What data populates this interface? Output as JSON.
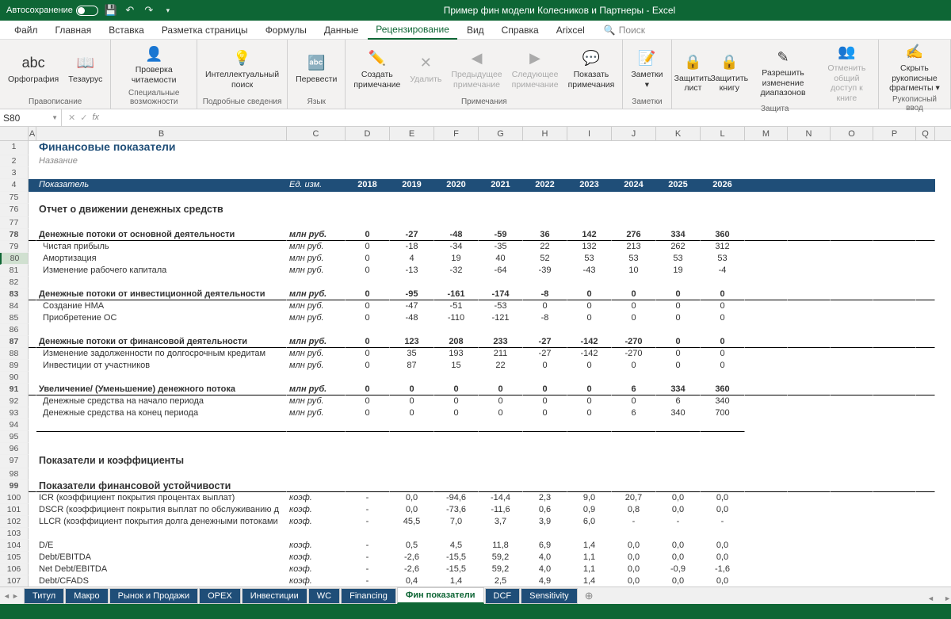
{
  "titlebar": {
    "autosave": "Автосохранение",
    "doc": "Пример фин модели Колесников и Партнеры - Excel"
  },
  "menu": [
    "Файл",
    "Главная",
    "Вставка",
    "Разметка страницы",
    "Формулы",
    "Данные",
    "Рецензирование",
    "Вид",
    "Справка",
    "Arixcel"
  ],
  "search": "Поиск",
  "ribbon": {
    "g1": {
      "label": "Правописание",
      "b": [
        {
          "t": "Орфография"
        },
        {
          "t": "Тезаурус"
        }
      ]
    },
    "g2": {
      "label": "Специальные возможности",
      "b": [
        {
          "t": "Проверка\nчитаемости"
        }
      ]
    },
    "g3": {
      "label": "Подробные сведения",
      "b": [
        {
          "t": "Интеллектуальный\nпоиск"
        }
      ]
    },
    "g4": {
      "label": "Язык",
      "b": [
        {
          "t": "Перевести"
        }
      ]
    },
    "g5": {
      "label": "Примечания",
      "b": [
        {
          "t": "Создать\nпримечание"
        },
        {
          "t": "Удалить",
          "d": true
        },
        {
          "t": "Предыдущее\nпримечание",
          "d": true
        },
        {
          "t": "Следующее\nпримечание",
          "d": true
        },
        {
          "t": "Показать\nпримечания"
        }
      ]
    },
    "g6": {
      "label": "Заметки",
      "b": [
        {
          "t": "Заметки\n▾"
        }
      ]
    },
    "g7": {
      "label": "Защита",
      "b": [
        {
          "t": "Защитить\nлист"
        },
        {
          "t": "Защитить\nкнигу"
        },
        {
          "t": "Разрешить изменение\nдиапазонов"
        },
        {
          "t": "Отменить общий\nдоступ к книге",
          "d": true
        }
      ]
    },
    "g8": {
      "label": "Рукописный ввод",
      "b": [
        {
          "t": "Скрыть рукописные\nфрагменты ▾"
        }
      ]
    }
  },
  "namebox": "S80",
  "cols": [
    "A",
    "B",
    "C",
    "D",
    "E",
    "F",
    "G",
    "H",
    "I",
    "J",
    "K",
    "L",
    "M",
    "N",
    "O",
    "P",
    "Q"
  ],
  "title": "Финансовые показатели",
  "subtitle": "Название",
  "hdr": {
    "label": "Показатель",
    "unit": "Ед. изм.",
    "years": [
      "2018",
      "2019",
      "2020",
      "2021",
      "2022",
      "2023",
      "2024",
      "2025",
      "2026"
    ]
  },
  "s1": "Отчет о движении денежных средств",
  "s2": "Показатели и коэффициенты",
  "s3": "Показатели финансовой устойчивости",
  "u_mln": "млн руб.",
  "u_k": "коэф.",
  "chart_data": {
    "type": "table",
    "rows": [
      {
        "r": 78,
        "b": 1,
        "name": "Денежные потоки от основной деятельности",
        "u": "млн руб.",
        "v": [
          "0",
          "-27",
          "-48",
          "-59",
          "36",
          "142",
          "276",
          "334",
          "360"
        ]
      },
      {
        "r": 79,
        "name": "Чистая прибыль",
        "u": "млн руб.",
        "v": [
          "0",
          "-18",
          "-34",
          "-35",
          "22",
          "132",
          "213",
          "262",
          "312"
        ]
      },
      {
        "r": 80,
        "name": "Амортизация",
        "u": "млн руб.",
        "v": [
          "0",
          "4",
          "19",
          "40",
          "52",
          "53",
          "53",
          "53",
          "53"
        ]
      },
      {
        "r": 81,
        "name": "Изменение рабочего капитала",
        "u": "млн руб.",
        "v": [
          "0",
          "-13",
          "-32",
          "-64",
          "-39",
          "-43",
          "10",
          "19",
          "-4"
        ]
      },
      {
        "r": 83,
        "b": 1,
        "name": "Денежные потоки от инвестиционной деятельности",
        "u": "млн руб.",
        "v": [
          "0",
          "-95",
          "-161",
          "-174",
          "-8",
          "0",
          "0",
          "0",
          "0"
        ]
      },
      {
        "r": 84,
        "name": "Создание НМА",
        "u": "млн руб.",
        "v": [
          "0",
          "-47",
          "-51",
          "-53",
          "0",
          "0",
          "0",
          "0",
          "0"
        ]
      },
      {
        "r": 85,
        "name": "Приобретение ОС",
        "u": "млн руб.",
        "v": [
          "0",
          "-48",
          "-110",
          "-121",
          "-8",
          "0",
          "0",
          "0",
          "0"
        ]
      },
      {
        "r": 87,
        "b": 1,
        "name": "Денежные потоки от финансовой деятельности",
        "u": "млн руб.",
        "v": [
          "0",
          "123",
          "208",
          "233",
          "-27",
          "-142",
          "-270",
          "0",
          "0"
        ]
      },
      {
        "r": 88,
        "name": "Изменение задолженности по долгосрочным кредитам",
        "u": "млн руб.",
        "v": [
          "0",
          "35",
          "193",
          "211",
          "-27",
          "-142",
          "-270",
          "0",
          "0"
        ]
      },
      {
        "r": 89,
        "name": "Инвестиции от участников",
        "u": "млн руб.",
        "v": [
          "0",
          "87",
          "15",
          "22",
          "0",
          "0",
          "0",
          "0",
          "0"
        ]
      },
      {
        "r": 91,
        "b": 1,
        "name": "Увеличение/ (Уменьшение) денежного потока",
        "u": "млн руб.",
        "v": [
          "0",
          "0",
          "0",
          "0",
          "0",
          "0",
          "6",
          "334",
          "360"
        ]
      },
      {
        "r": 92,
        "name": "Денежные средства на начало периода",
        "u": "млн руб.",
        "v": [
          "0",
          "0",
          "0",
          "0",
          "0",
          "0",
          "0",
          "6",
          "340"
        ]
      },
      {
        "r": 93,
        "name": "Денежные средства на конец периода",
        "u": "млн руб.",
        "v": [
          "0",
          "0",
          "0",
          "0",
          "0",
          "0",
          "6",
          "340",
          "700"
        ]
      },
      {
        "r": 100,
        "name": "ICR (коэффициент покрытия процентах выплат)",
        "u": "коэф.",
        "v": [
          "-",
          "0,0",
          "-94,6",
          "-14,4",
          "2,3",
          "9,0",
          "20,7",
          "0,0",
          "0,0"
        ]
      },
      {
        "r": 101,
        "name": "DSCR (коэффициент покрытия выплат по обслуживанию д",
        "u": "коэф.",
        "v": [
          "-",
          "0,0",
          "-73,6",
          "-11,6",
          "0,6",
          "0,9",
          "0,8",
          "0,0",
          "0,0"
        ]
      },
      {
        "r": 102,
        "name": "LLCR (коэффициент покрытия долга денежными потоками",
        "u": "коэф.",
        "v": [
          "-",
          "45,5",
          "7,0",
          "3,7",
          "3,9",
          "6,0",
          "-",
          "-",
          "-"
        ]
      },
      {
        "r": 104,
        "name": "D/E",
        "u": "коэф.",
        "v": [
          "-",
          "0,5",
          "4,5",
          "11,8",
          "6,9",
          "1,4",
          "0,0",
          "0,0",
          "0,0"
        ]
      },
      {
        "r": 105,
        "name": "Debt/EBITDA",
        "u": "коэф.",
        "v": [
          "-",
          "-2,6",
          "-15,5",
          "59,2",
          "4,0",
          "1,1",
          "0,0",
          "0,0",
          "0,0"
        ]
      },
      {
        "r": 106,
        "name": "Net Debt/EBITDA",
        "u": "коэф.",
        "v": [
          "-",
          "-2,6",
          "-15,5",
          "59,2",
          "4,0",
          "1,1",
          "0,0",
          "-0,9",
          "-1,6"
        ]
      },
      {
        "r": 107,
        "name": "Debt/CFADS",
        "u": "коэф.",
        "v": [
          "-",
          "0,4",
          "1,4",
          "2,5",
          "4,9",
          "1,4",
          "0,0",
          "0,0",
          "0,0"
        ]
      }
    ]
  },
  "tabs": [
    "Титул",
    "Макро",
    "Рынок и Продажи",
    "OPEX",
    "Инвестиции",
    "WC",
    "Financing",
    "Фин показатели",
    "DCF",
    "Sensitivity"
  ],
  "active_tab": "Фин показатели"
}
